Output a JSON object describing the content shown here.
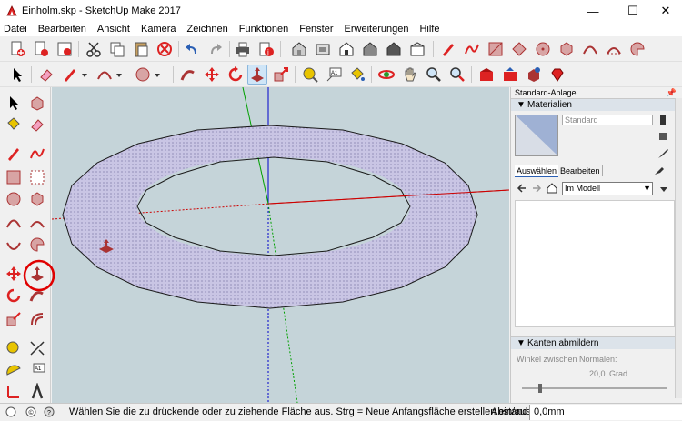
{
  "window": {
    "title": "Einholm.skp - SketchUp Make 2017",
    "minimize": "—",
    "maximize": "☐",
    "close": "✕"
  },
  "menu": [
    "Datei",
    "Bearbeiten",
    "Ansicht",
    "Kamera",
    "Zeichnen",
    "Funktionen",
    "Fenster",
    "Erweiterungen",
    "Hilfe"
  ],
  "tray": {
    "title": "Standard-Ablage",
    "materials": {
      "header": "Materialien",
      "material_name": "Standard",
      "tab_select": "Auswählen",
      "tab_edit": "Bearbeiten",
      "library_value": "Im Modell"
    },
    "soften": {
      "header": "Kanten abmildern",
      "angle_label": "Winkel zwischen Normalen:",
      "angle_value": "20,0",
      "angle_unit": "Grad"
    }
  },
  "status": {
    "message": "Wählen Sie die zu drückende oder zu ziehende Fläche aus.  Strg = Neue Anfangsfläche erstellen ein/aus",
    "measure_label": "Abstand",
    "measure_value": "0,0mm"
  },
  "colors": {
    "viewport_bg": "#c5d4d9",
    "face_fill": "#c9c5e4",
    "axis_red": "#cc0000",
    "axis_green": "#00a000",
    "axis_blue": "#0000cc",
    "highlight_red": "#e00000",
    "active_tool": "#cfe5f7"
  },
  "icons": {
    "active_tool": "push-pull-icon"
  }
}
